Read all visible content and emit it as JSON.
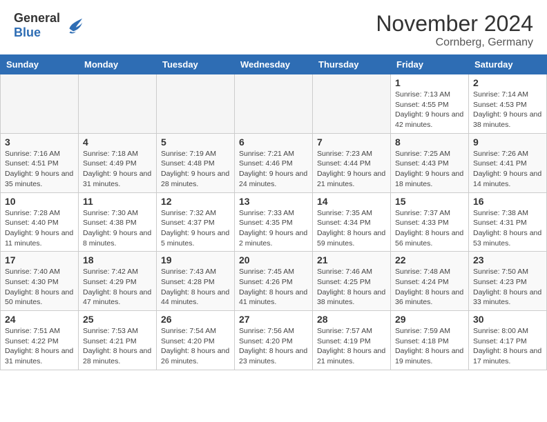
{
  "header": {
    "logo_general": "General",
    "logo_blue": "Blue",
    "month_title": "November 2024",
    "location": "Cornberg, Germany"
  },
  "calendar": {
    "days_of_week": [
      "Sunday",
      "Monday",
      "Tuesday",
      "Wednesday",
      "Thursday",
      "Friday",
      "Saturday"
    ],
    "weeks": [
      {
        "days": [
          {
            "empty": true
          },
          {
            "empty": true
          },
          {
            "empty": true
          },
          {
            "empty": true
          },
          {
            "empty": true
          },
          {
            "number": "1",
            "sunrise": "7:13 AM",
            "sunset": "4:55 PM",
            "daylight": "9 hours and 42 minutes."
          },
          {
            "number": "2",
            "sunrise": "7:14 AM",
            "sunset": "4:53 PM",
            "daylight": "9 hours and 38 minutes."
          }
        ]
      },
      {
        "days": [
          {
            "number": "3",
            "sunrise": "7:16 AM",
            "sunset": "4:51 PM",
            "daylight": "9 hours and 35 minutes."
          },
          {
            "number": "4",
            "sunrise": "7:18 AM",
            "sunset": "4:49 PM",
            "daylight": "9 hours and 31 minutes."
          },
          {
            "number": "5",
            "sunrise": "7:19 AM",
            "sunset": "4:48 PM",
            "daylight": "9 hours and 28 minutes."
          },
          {
            "number": "6",
            "sunrise": "7:21 AM",
            "sunset": "4:46 PM",
            "daylight": "9 hours and 24 minutes."
          },
          {
            "number": "7",
            "sunrise": "7:23 AM",
            "sunset": "4:44 PM",
            "daylight": "9 hours and 21 minutes."
          },
          {
            "number": "8",
            "sunrise": "7:25 AM",
            "sunset": "4:43 PM",
            "daylight": "9 hours and 18 minutes."
          },
          {
            "number": "9",
            "sunrise": "7:26 AM",
            "sunset": "4:41 PM",
            "daylight": "9 hours and 14 minutes."
          }
        ]
      },
      {
        "days": [
          {
            "number": "10",
            "sunrise": "7:28 AM",
            "sunset": "4:40 PM",
            "daylight": "9 hours and 11 minutes."
          },
          {
            "number": "11",
            "sunrise": "7:30 AM",
            "sunset": "4:38 PM",
            "daylight": "9 hours and 8 minutes."
          },
          {
            "number": "12",
            "sunrise": "7:32 AM",
            "sunset": "4:37 PM",
            "daylight": "9 hours and 5 minutes."
          },
          {
            "number": "13",
            "sunrise": "7:33 AM",
            "sunset": "4:35 PM",
            "daylight": "9 hours and 2 minutes."
          },
          {
            "number": "14",
            "sunrise": "7:35 AM",
            "sunset": "4:34 PM",
            "daylight": "8 hours and 59 minutes."
          },
          {
            "number": "15",
            "sunrise": "7:37 AM",
            "sunset": "4:33 PM",
            "daylight": "8 hours and 56 minutes."
          },
          {
            "number": "16",
            "sunrise": "7:38 AM",
            "sunset": "4:31 PM",
            "daylight": "8 hours and 53 minutes."
          }
        ]
      },
      {
        "days": [
          {
            "number": "17",
            "sunrise": "7:40 AM",
            "sunset": "4:30 PM",
            "daylight": "8 hours and 50 minutes."
          },
          {
            "number": "18",
            "sunrise": "7:42 AM",
            "sunset": "4:29 PM",
            "daylight": "8 hours and 47 minutes."
          },
          {
            "number": "19",
            "sunrise": "7:43 AM",
            "sunset": "4:28 PM",
            "daylight": "8 hours and 44 minutes."
          },
          {
            "number": "20",
            "sunrise": "7:45 AM",
            "sunset": "4:26 PM",
            "daylight": "8 hours and 41 minutes."
          },
          {
            "number": "21",
            "sunrise": "7:46 AM",
            "sunset": "4:25 PM",
            "daylight": "8 hours and 38 minutes."
          },
          {
            "number": "22",
            "sunrise": "7:48 AM",
            "sunset": "4:24 PM",
            "daylight": "8 hours and 36 minutes."
          },
          {
            "number": "23",
            "sunrise": "7:50 AM",
            "sunset": "4:23 PM",
            "daylight": "8 hours and 33 minutes."
          }
        ]
      },
      {
        "days": [
          {
            "number": "24",
            "sunrise": "7:51 AM",
            "sunset": "4:22 PM",
            "daylight": "8 hours and 31 minutes."
          },
          {
            "number": "25",
            "sunrise": "7:53 AM",
            "sunset": "4:21 PM",
            "daylight": "8 hours and 28 minutes."
          },
          {
            "number": "26",
            "sunrise": "7:54 AM",
            "sunset": "4:20 PM",
            "daylight": "8 hours and 26 minutes."
          },
          {
            "number": "27",
            "sunrise": "7:56 AM",
            "sunset": "4:20 PM",
            "daylight": "8 hours and 23 minutes."
          },
          {
            "number": "28",
            "sunrise": "7:57 AM",
            "sunset": "4:19 PM",
            "daylight": "8 hours and 21 minutes."
          },
          {
            "number": "29",
            "sunrise": "7:59 AM",
            "sunset": "4:18 PM",
            "daylight": "8 hours and 19 minutes."
          },
          {
            "number": "30",
            "sunrise": "8:00 AM",
            "sunset": "4:17 PM",
            "daylight": "8 hours and 17 minutes."
          }
        ]
      }
    ]
  }
}
